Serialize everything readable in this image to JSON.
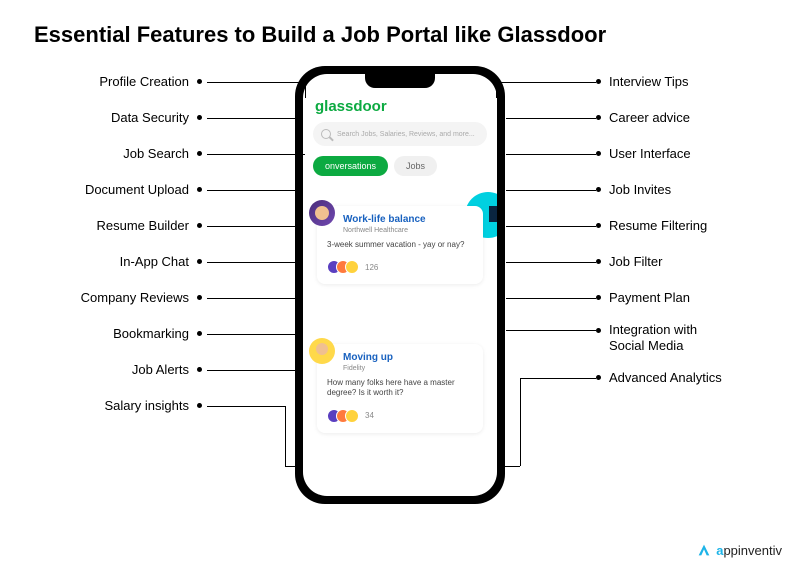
{
  "title": "Essential Features to Build a Job Portal like Glassdoor",
  "brand": "glassdoor",
  "search_placeholder": "Search Jobs, Salaries, Reviews, and more...",
  "tabs": {
    "conversations": "onversations",
    "jobs": "Jobs"
  },
  "cards": [
    {
      "title": "Work-life balance",
      "subtitle": "Northwell Healthcare",
      "body": "3-week summer vacation - yay or nay?",
      "count": "126"
    },
    {
      "title": "Moving up",
      "subtitle": "Fidelity",
      "body": "How many folks here have a master degree? Is it worth it?",
      "count": "34"
    }
  ],
  "left_features": [
    "Profile Creation",
    "Data Security",
    "Job Search",
    "Document Upload",
    "Resume Builder",
    "In-App Chat",
    "Company Reviews",
    "Bookmarking",
    "Job Alerts",
    "Salary insights"
  ],
  "right_features": [
    "Interview Tips",
    "Career advice",
    "User Interface",
    "Job Invites",
    "Resume Filtering",
    "Job Filter",
    "Payment Plan",
    "Integration with\nSocial Media",
    "Advanced Analytics"
  ],
  "footer_brand": {
    "accent": "a",
    "rest": "ppinventiv"
  }
}
